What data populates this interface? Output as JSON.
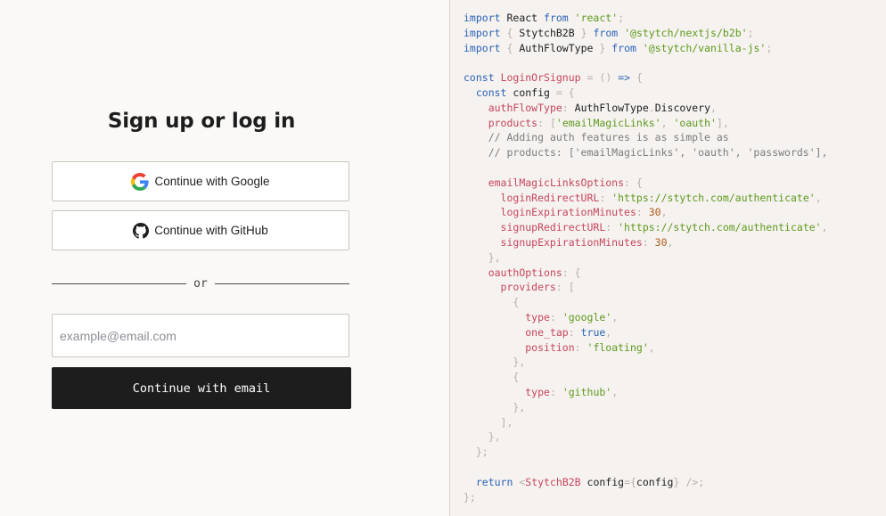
{
  "login": {
    "title": "Sign up or log in",
    "google_label": "Continue with Google",
    "github_label": "Continue with GitHub",
    "divider_text": "or",
    "email_placeholder": "example@email.com",
    "email_button_label": "Continue with email"
  },
  "code": {
    "lines": [
      [
        [
          "k",
          "import"
        ],
        [
          "n",
          " React "
        ],
        [
          "k",
          "from"
        ],
        [
          "n",
          " "
        ],
        [
          "s",
          "'react'"
        ],
        [
          "p",
          ";"
        ]
      ],
      [
        [
          "k",
          "import"
        ],
        [
          "n",
          " "
        ],
        [
          "p",
          "{"
        ],
        [
          "n",
          " StytchB2B "
        ],
        [
          "p",
          "}"
        ],
        [
          "n",
          " "
        ],
        [
          "k",
          "from"
        ],
        [
          "n",
          " "
        ],
        [
          "s",
          "'@stytch/nextjs/b2b'"
        ],
        [
          "p",
          ";"
        ]
      ],
      [
        [
          "k",
          "import"
        ],
        [
          "n",
          " "
        ],
        [
          "p",
          "{"
        ],
        [
          "n",
          " AuthFlowType "
        ],
        [
          "p",
          "}"
        ],
        [
          "n",
          " "
        ],
        [
          "k",
          "from"
        ],
        [
          "n",
          " "
        ],
        [
          "s",
          "'@stytch/vanilla-js'"
        ],
        [
          "p",
          ";"
        ]
      ],
      [],
      [
        [
          "k",
          "const"
        ],
        [
          "n",
          " "
        ],
        [
          "v",
          "LoginOrSignup"
        ],
        [
          "n",
          " "
        ],
        [
          "p",
          "="
        ],
        [
          "n",
          " "
        ],
        [
          "p",
          "()"
        ],
        [
          "n",
          " "
        ],
        [
          "k",
          "=>"
        ],
        [
          "n",
          " "
        ],
        [
          "p",
          "{"
        ]
      ],
      [
        [
          "n",
          "  "
        ],
        [
          "k",
          "const"
        ],
        [
          "n",
          " config "
        ],
        [
          "p",
          "="
        ],
        [
          "n",
          " "
        ],
        [
          "p",
          "{"
        ]
      ],
      [
        [
          "n",
          "    "
        ],
        [
          "v",
          "authFlowType"
        ],
        [
          "p",
          ":"
        ],
        [
          "n",
          " AuthFlowType"
        ],
        [
          "p",
          "."
        ],
        [
          "n",
          "Discovery"
        ],
        [
          "p",
          ","
        ]
      ],
      [
        [
          "n",
          "    "
        ],
        [
          "v",
          "products"
        ],
        [
          "p",
          ":"
        ],
        [
          "n",
          " "
        ],
        [
          "p",
          "["
        ],
        [
          "s",
          "'emailMagicLinks'"
        ],
        [
          "p",
          ","
        ],
        [
          "n",
          " "
        ],
        [
          "s",
          "'oauth'"
        ],
        [
          "p",
          "],"
        ]
      ],
      [
        [
          "n",
          "    "
        ],
        [
          "c",
          "// Adding auth features is as simple as"
        ]
      ],
      [
        [
          "n",
          "    "
        ],
        [
          "c",
          "// products: ['emailMagicLinks', 'oauth', 'passwords'],"
        ]
      ],
      [],
      [
        [
          "n",
          "    "
        ],
        [
          "v",
          "emailMagicLinksOptions"
        ],
        [
          "p",
          ":"
        ],
        [
          "n",
          " "
        ],
        [
          "p",
          "{"
        ]
      ],
      [
        [
          "n",
          "      "
        ],
        [
          "v",
          "loginRedirectURL"
        ],
        [
          "p",
          ":"
        ],
        [
          "n",
          " "
        ],
        [
          "s",
          "'https://stytch.com/authenticate'"
        ],
        [
          "p",
          ","
        ]
      ],
      [
        [
          "n",
          "      "
        ],
        [
          "v",
          "loginExpirationMinutes"
        ],
        [
          "p",
          ":"
        ],
        [
          "n",
          " "
        ],
        [
          "num",
          "30"
        ],
        [
          "p",
          ","
        ]
      ],
      [
        [
          "n",
          "      "
        ],
        [
          "v",
          "signupRedirectURL"
        ],
        [
          "p",
          ":"
        ],
        [
          "n",
          " "
        ],
        [
          "s",
          "'https://stytch.com/authenticate'"
        ],
        [
          "p",
          ","
        ]
      ],
      [
        [
          "n",
          "      "
        ],
        [
          "v",
          "signupExpirationMinutes"
        ],
        [
          "p",
          ":"
        ],
        [
          "n",
          " "
        ],
        [
          "num",
          "30"
        ],
        [
          "p",
          ","
        ]
      ],
      [
        [
          "n",
          "    "
        ],
        [
          "p",
          "},"
        ]
      ],
      [
        [
          "n",
          "    "
        ],
        [
          "v",
          "oauthOptions"
        ],
        [
          "p",
          ":"
        ],
        [
          "n",
          " "
        ],
        [
          "p",
          "{"
        ]
      ],
      [
        [
          "n",
          "      "
        ],
        [
          "v",
          "providers"
        ],
        [
          "p",
          ":"
        ],
        [
          "n",
          " "
        ],
        [
          "p",
          "["
        ]
      ],
      [
        [
          "n",
          "        "
        ],
        [
          "p",
          "{"
        ]
      ],
      [
        [
          "n",
          "          "
        ],
        [
          "v",
          "type"
        ],
        [
          "p",
          ":"
        ],
        [
          "n",
          " "
        ],
        [
          "s",
          "'google'"
        ],
        [
          "p",
          ","
        ]
      ],
      [
        [
          "n",
          "          "
        ],
        [
          "v",
          "one_tap"
        ],
        [
          "p",
          ":"
        ],
        [
          "n",
          " "
        ],
        [
          "k",
          "true"
        ],
        [
          "p",
          ","
        ]
      ],
      [
        [
          "n",
          "          "
        ],
        [
          "v",
          "position"
        ],
        [
          "p",
          ":"
        ],
        [
          "n",
          " "
        ],
        [
          "s",
          "'floating'"
        ],
        [
          "p",
          ","
        ]
      ],
      [
        [
          "n",
          "        "
        ],
        [
          "p",
          "},"
        ]
      ],
      [
        [
          "n",
          "        "
        ],
        [
          "p",
          "{"
        ]
      ],
      [
        [
          "n",
          "          "
        ],
        [
          "v",
          "type"
        ],
        [
          "p",
          ":"
        ],
        [
          "n",
          " "
        ],
        [
          "s",
          "'github'"
        ],
        [
          "p",
          ","
        ]
      ],
      [
        [
          "n",
          "        "
        ],
        [
          "p",
          "},"
        ]
      ],
      [
        [
          "n",
          "      "
        ],
        [
          "p",
          "],"
        ]
      ],
      [
        [
          "n",
          "    "
        ],
        [
          "p",
          "},"
        ]
      ],
      [
        [
          "n",
          "  "
        ],
        [
          "p",
          "};"
        ]
      ],
      [],
      [
        [
          "n",
          "  "
        ],
        [
          "k",
          "return"
        ],
        [
          "n",
          " "
        ],
        [
          "p",
          "<"
        ],
        [
          "v",
          "StytchB2B"
        ],
        [
          "n",
          " config"
        ],
        [
          "p",
          "={"
        ],
        [
          "n",
          "config"
        ],
        [
          "p",
          "}"
        ],
        [
          "n",
          " "
        ],
        [
          "p",
          "/>;"
        ]
      ],
      [
        [
          "p",
          "};"
        ]
      ]
    ]
  }
}
